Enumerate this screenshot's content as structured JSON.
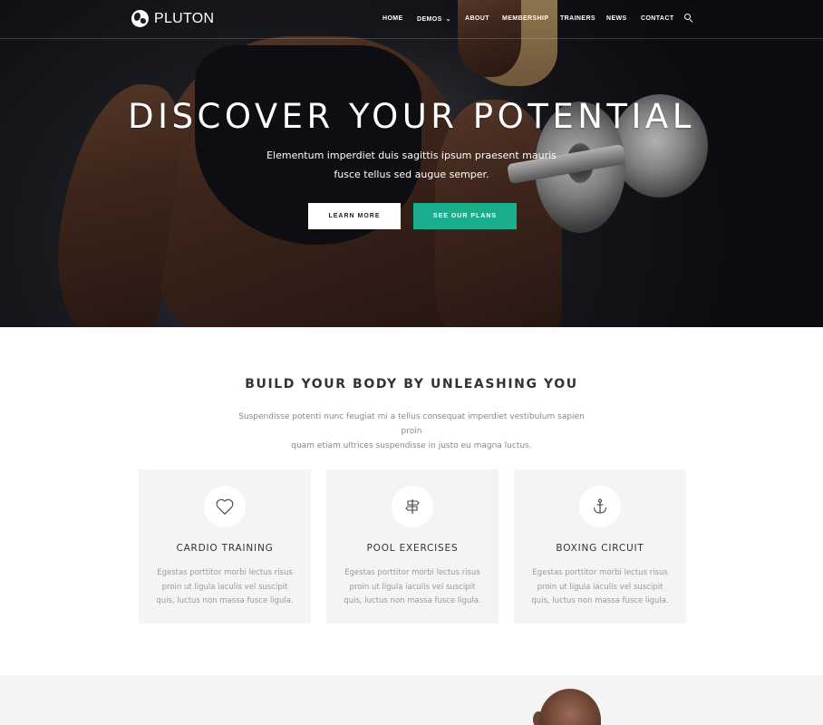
{
  "brand": {
    "name": "PLUTON"
  },
  "nav": {
    "items": [
      {
        "label": "HOME"
      },
      {
        "label": "DEMOS"
      },
      {
        "label": "ABOUT"
      },
      {
        "label": "MEMBERSHIP"
      },
      {
        "label": "TRAINERS"
      },
      {
        "label": "NEWS"
      },
      {
        "label": "CONTACT"
      }
    ]
  },
  "hero": {
    "title": "DISCOVER YOUR POTENTIAL",
    "subtitle_line1": "Elementum imperdiet duis sagittis ipsum praesent mauris",
    "subtitle_line2": "fusce tellus sed augue semper.",
    "primary_button": "LEARN MORE",
    "secondary_button": "SEE OUR PLANS"
  },
  "features": {
    "title": "BUILD YOUR BODY BY UNLEASHING YOU",
    "description_line1": "Suspendisse potenti nunc feugiat mi a tellus consequat imperdiet vestibulum sapien proin",
    "description_line2": "quam etiam ultrices suspendisse in justo eu magna luctus.",
    "cards": [
      {
        "icon": "heart-icon",
        "title": "CARDIO TRAINING",
        "text_line1": "Egestas porttitor morbi lectus risus",
        "text_line2": "proin ut ligula iaculis vel suscipit",
        "text_line3": "quis, luctus non massa fusce ligula."
      },
      {
        "icon": "signpost-icon",
        "title": "POOL EXERCISES",
        "text_line1": "Egestas porttitor morbi lectus risus",
        "text_line2": "proin ut ligula iaculis vel suscipit",
        "text_line3": "quis, luctus non massa fusce ligula."
      },
      {
        "icon": "anchor-icon",
        "title": "BOXING CIRCUIT",
        "text_line1": "Egestas porttitor morbi lectus risus",
        "text_line2": "proin ut ligula iaculis vel suscipit",
        "text_line3": "quis, luctus non massa fusce ligula."
      }
    ]
  },
  "colors": {
    "accent": "#1aae8c",
    "card_bg": "#f4f4f4",
    "hero_text": "#ffffff"
  }
}
